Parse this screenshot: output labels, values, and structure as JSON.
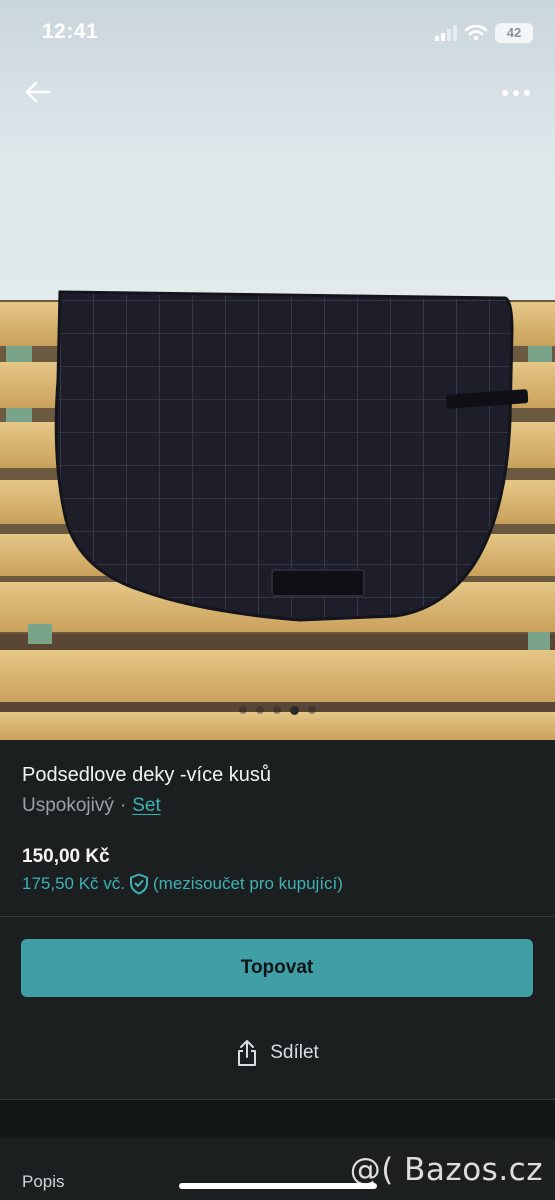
{
  "status_bar": {
    "time": "12:41",
    "battery": "42"
  },
  "nav": {
    "back_icon": "arrow-left-icon",
    "more_icon": "more-horizontal-icon"
  },
  "gallery": {
    "image_count": 5,
    "active_index": 3
  },
  "listing": {
    "title": "Podsedlove deky -více kusů",
    "condition": "Uspokojivý",
    "separator": "·",
    "category_link": "Set",
    "price": "150,00 Kč",
    "buyer_price": "175,50 Kč vč.",
    "buyer_note": "(mezisoučet pro kupující)"
  },
  "actions": {
    "promote_label": "Topovat",
    "share_label": "Sdílet"
  },
  "description": {
    "label": "Popis"
  },
  "watermark": "@( Bazos.cz",
  "colors": {
    "accent": "#3f9ea6",
    "link": "#3fb1b5",
    "background": "#1b1f20"
  }
}
